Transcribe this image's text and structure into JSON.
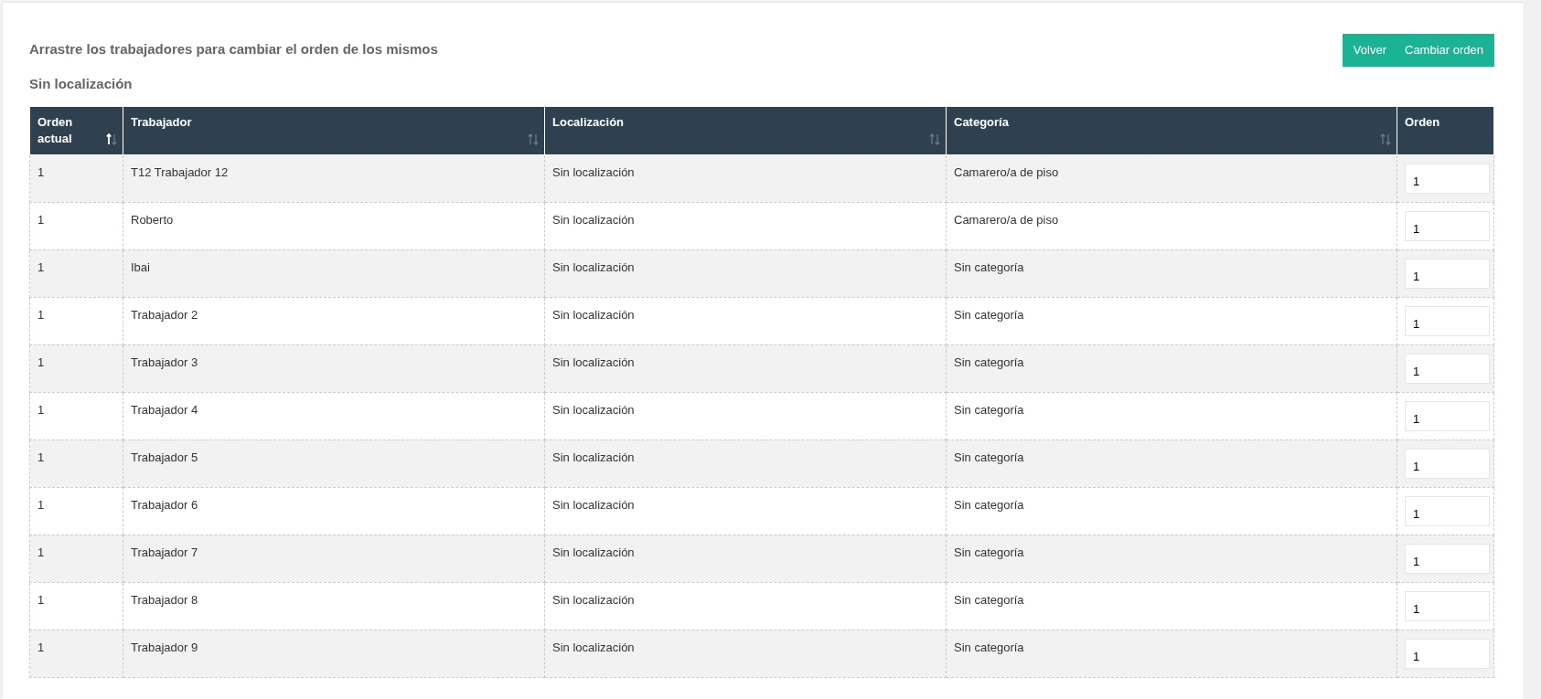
{
  "heading": "Arrastre los trabajadores para cambiar el orden de los mismos",
  "buttons": [
    "Volver",
    "Cambiar orden"
  ],
  "section_title": "Sin localización",
  "table": {
    "columns": [
      {
        "label": "Orden actual",
        "sortable": true,
        "sorted": true
      },
      {
        "label": "Trabajador",
        "sortable": true,
        "sorted": false
      },
      {
        "label": "Localización",
        "sortable": true,
        "sorted": false
      },
      {
        "label": "Categoría",
        "sortable": true,
        "sorted": false
      },
      {
        "label": "Orden",
        "sortable": false
      }
    ],
    "rows": [
      {
        "current": "1",
        "worker": "T12 Trabajador 12",
        "location": "Sin localización",
        "category": "Camarero/a de piso",
        "order": "1"
      },
      {
        "current": "1",
        "worker": "Roberto",
        "location": "Sin localización",
        "category": "Camarero/a de piso",
        "order": "1"
      },
      {
        "current": "1",
        "worker": "Ibai",
        "location": "Sin localización",
        "category": "Sin categoría",
        "order": "1"
      },
      {
        "current": "1",
        "worker": "Trabajador 2",
        "location": "Sin localización",
        "category": "Sin categoría",
        "order": "1"
      },
      {
        "current": "1",
        "worker": "Trabajador 3",
        "location": "Sin localización",
        "category": "Sin categoría",
        "order": "1"
      },
      {
        "current": "1",
        "worker": "Trabajador 4",
        "location": "Sin localización",
        "category": "Sin categoría",
        "order": "1"
      },
      {
        "current": "1",
        "worker": "Trabajador 5",
        "location": "Sin localización",
        "category": "Sin categoría",
        "order": "1"
      },
      {
        "current": "1",
        "worker": "Trabajador 6",
        "location": "Sin localización",
        "category": "Sin categoría",
        "order": "1"
      },
      {
        "current": "1",
        "worker": "Trabajador 7",
        "location": "Sin localización",
        "category": "Sin categoría",
        "order": "1"
      },
      {
        "current": "1",
        "worker": "Trabajador 8",
        "location": "Sin localización",
        "category": "Sin categoría",
        "order": "1"
      },
      {
        "current": "1",
        "worker": "Trabajador 9",
        "location": "Sin localización",
        "category": "Sin categoría",
        "order": "1"
      }
    ]
  }
}
